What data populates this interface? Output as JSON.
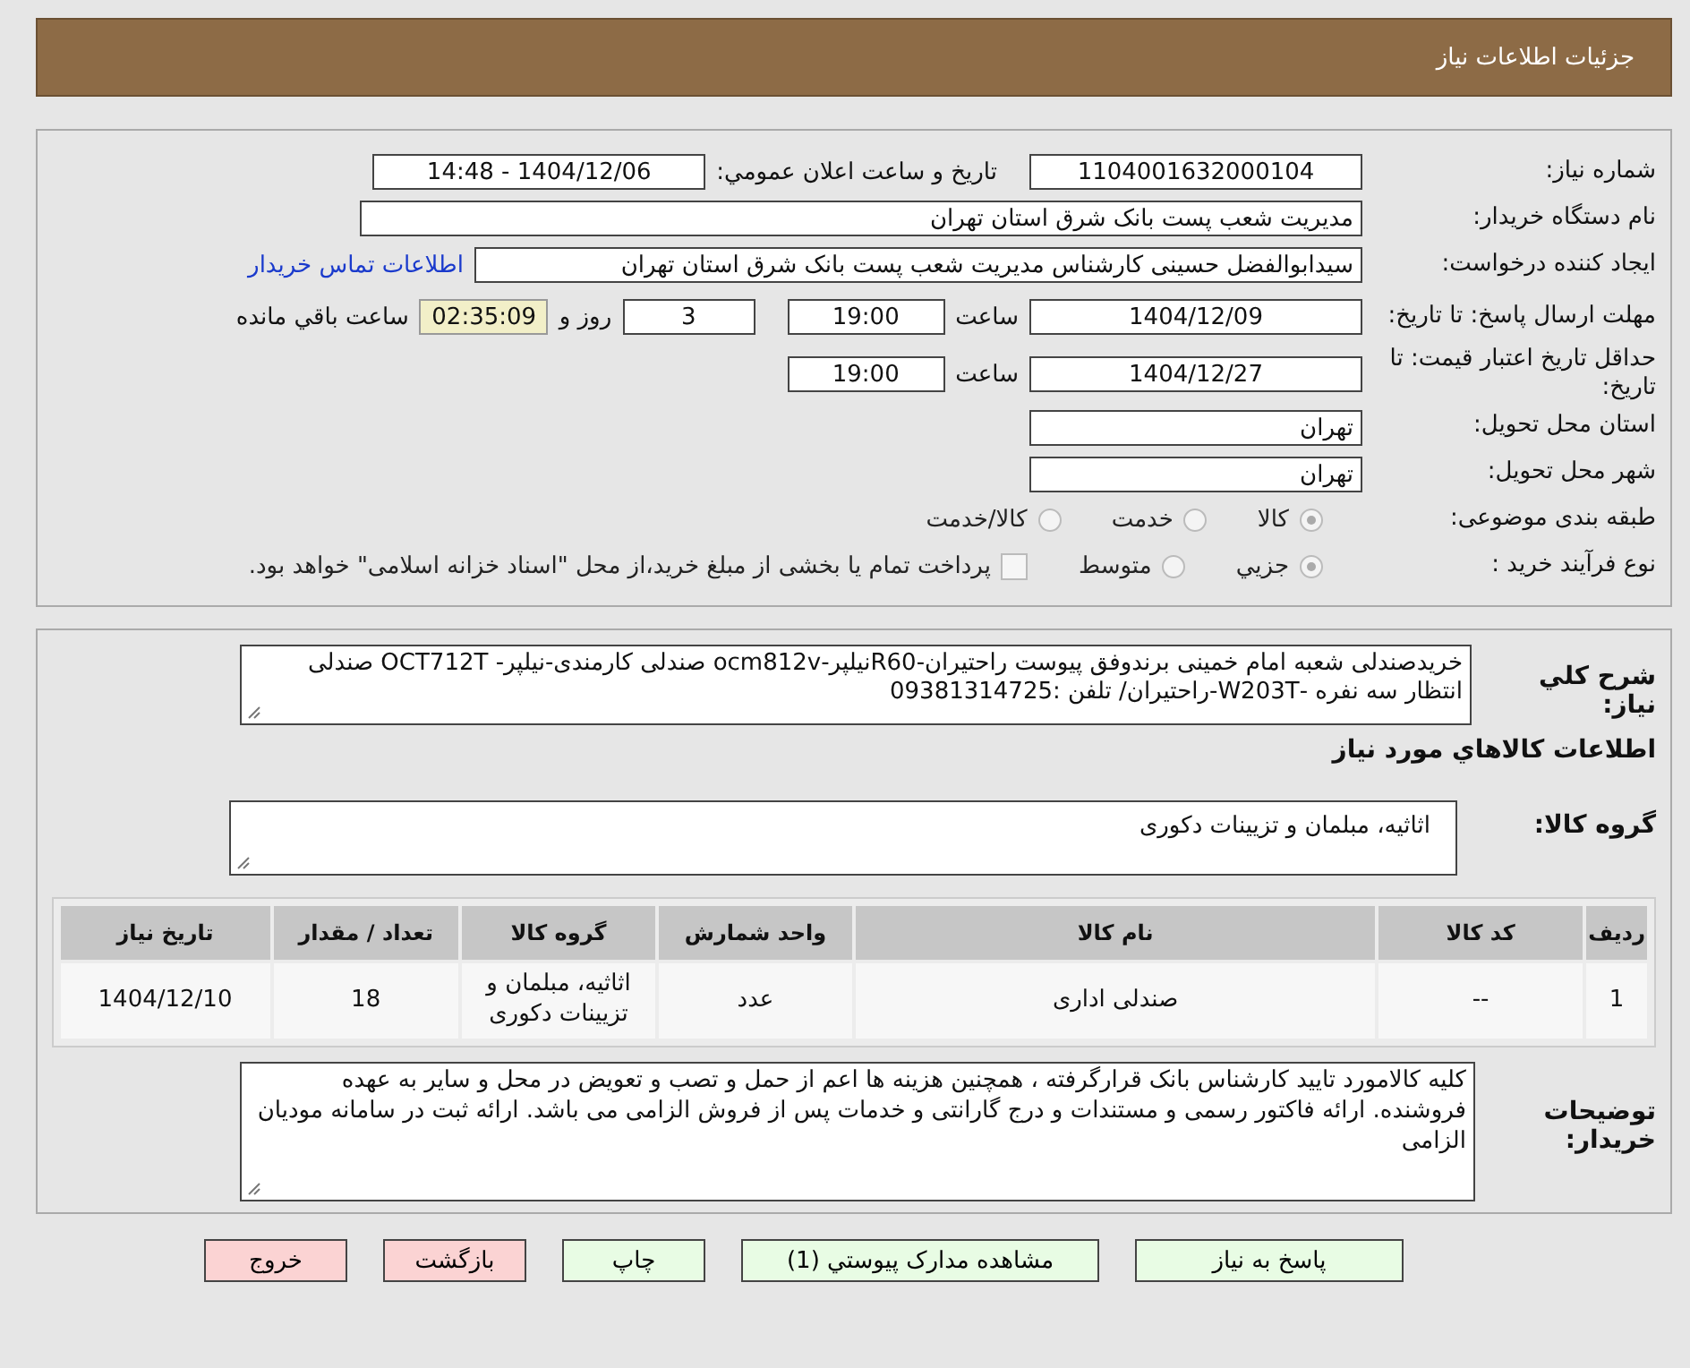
{
  "header": {
    "title": "جزئیات اطلاعات نیاز"
  },
  "details": {
    "need_number": {
      "label": "شماره نیاز:",
      "value": "1104001632000104"
    },
    "announce": {
      "label": "تاریخ و ساعت اعلان عمومي:",
      "value": "1404/12/06 - 14:48"
    },
    "buyer_org": {
      "label": "نام دستگاه خریدار:",
      "value": "مدیریت شعب پست بانک شرق استان تهران"
    },
    "requester": {
      "label": "ایجاد کننده درخواست:",
      "value": "سیدابوالفضل حسینی کارشناس مدیریت شعب پست بانک شرق استان تهران",
      "link": "اطلاعات تماس خریدار"
    },
    "deadline": {
      "label": "مهلت ارسال پاسخ: تا تاریخ:",
      "date": "1404/12/09",
      "time_label": "ساعت",
      "time": "19:00",
      "days": "3",
      "days_label": "روز و",
      "remaining": "02:35:09",
      "remaining_label": "ساعت باقي مانده"
    },
    "price_validity": {
      "label": "حداقل تاریخ اعتبار قیمت: تا تاریخ:",
      "date": "1404/12/27",
      "time_label": "ساعت",
      "time": "19:00"
    },
    "province": {
      "label": "استان محل تحویل:",
      "value": "تهران"
    },
    "city": {
      "label": "شهر محل تحویل:",
      "value": "تهران"
    },
    "category": {
      "label": "طبقه بندی موضوعی:",
      "options": [
        {
          "label": "کالا",
          "selected": true
        },
        {
          "label": "خدمت",
          "selected": false
        },
        {
          "label": "کالا/خدمت",
          "selected": false
        }
      ]
    },
    "process": {
      "label": "نوع فرآیند خرید :",
      "options": [
        {
          "label": "جزيي",
          "selected": true
        },
        {
          "label": "متوسط",
          "selected": false
        }
      ],
      "treasury": {
        "label": "پرداخت تمام یا بخشی از مبلغ خرید،از محل \"اسناد خزانه اسلامی\" خواهد بود.",
        "checked": false
      }
    }
  },
  "needs": {
    "description": {
      "label": "شرح کلي نیاز:",
      "value": "خریدصندلی شعبه امام خمینی برندوفق پیوست راحتیران-R60نیلپر-ocm812v صندلی کارمندی-نیلپر- OCT712T صندلی انتظار سه نفره -W203T-راحتیران/ تلفن :09381314725"
    },
    "goods_heading": "اطلاعات کالاهاي مورد نیاز",
    "group": {
      "label": "گروه کالا:",
      "value": "اثاثیه، مبلمان و تزیینات دکوری"
    },
    "table": {
      "columns": [
        "ردیف",
        "کد کالا",
        "نام کالا",
        "واحد شمارش",
        "گروه کالا",
        "تعداد / مقدار",
        "تاریخ نیاز"
      ],
      "rows": [
        [
          "1",
          "--",
          "صندلی اداری",
          "عدد",
          "اثاثیه، مبلمان و تزیینات دکوری",
          "18",
          "1404/12/10"
        ]
      ]
    },
    "notes": {
      "label": "توضیحات خریدار:",
      "value": "کلیه کالامورد تایید کارشناس بانک قرارگرفته ، همچنین هزینه ها اعم از حمل و تصب و تعویض در محل  و سایر به عهده فروشنده. ارائه فاکتور رسمی و مستندات و درج گارانتی و خدمات پس از فروش الزامی می باشد. ارائه ثبت در سامانه مودیان الزامی"
    }
  },
  "buttons": [
    {
      "label": "پاسخ به نیاز",
      "kind": "primary"
    },
    {
      "label": "مشاهده مدارک پیوستي (1)",
      "kind": "primary"
    },
    {
      "label": "چاپ",
      "kind": "primary"
    },
    {
      "label": "بازگشت",
      "kind": "danger"
    },
    {
      "label": "خروج",
      "kind": "danger"
    }
  ]
}
